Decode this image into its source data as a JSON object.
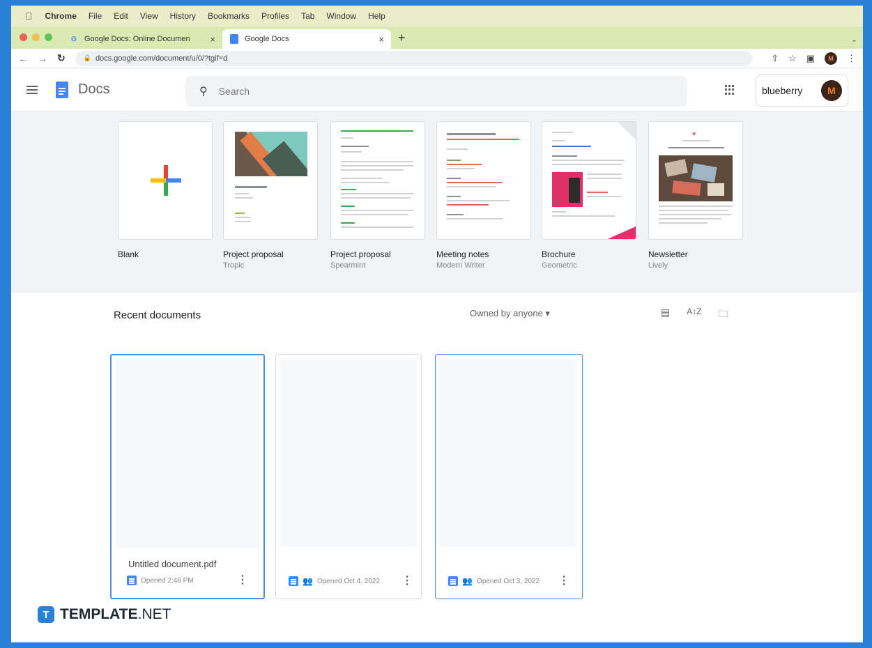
{
  "macbar": {
    "app": "Chrome",
    "menus": [
      "File",
      "Edit",
      "View",
      "History",
      "Bookmarks",
      "Profiles",
      "Tab",
      "Window",
      "Help"
    ]
  },
  "tabs": [
    {
      "title": "Google Docs: Online Documen",
      "close": "×"
    },
    {
      "title": "Google Docs",
      "close": "×"
    }
  ],
  "new_tab": "+",
  "address": {
    "url": "docs.google.com/document/u/0/?tgif=d"
  },
  "header": {
    "app_name": "Docs",
    "search_placeholder": "Search",
    "account_label": "blueberry",
    "avatar_letter": "M"
  },
  "templates": [
    {
      "title": "Blank",
      "subtitle": ""
    },
    {
      "title": "Project proposal",
      "subtitle": "Tropic"
    },
    {
      "title": "Project proposal",
      "subtitle": "Spearmint"
    },
    {
      "title": "Meeting notes",
      "subtitle": "Modern Writer"
    },
    {
      "title": "Brochure",
      "subtitle": "Geometric"
    },
    {
      "title": "Newsletter",
      "subtitle": "Lively"
    }
  ],
  "recent": {
    "title": "Recent documents",
    "owner_filter": "Owned by anyone ▾",
    "docs": [
      {
        "title": "Untitled document.pdf",
        "opened": "Opened 2:48 PM"
      },
      {
        "title": "",
        "opened": "Opened Oct 4, 2022"
      },
      {
        "title": "",
        "opened": "Opened Oct 3, 2022"
      }
    ]
  },
  "brand": {
    "icon": "T",
    "name_bold": "TEMPLATE",
    "name_rest": ".NET"
  },
  "colors": {
    "docs_blue": "#4285f4",
    "selection": "#4a8fe0",
    "frame": "#2a7fd6"
  }
}
